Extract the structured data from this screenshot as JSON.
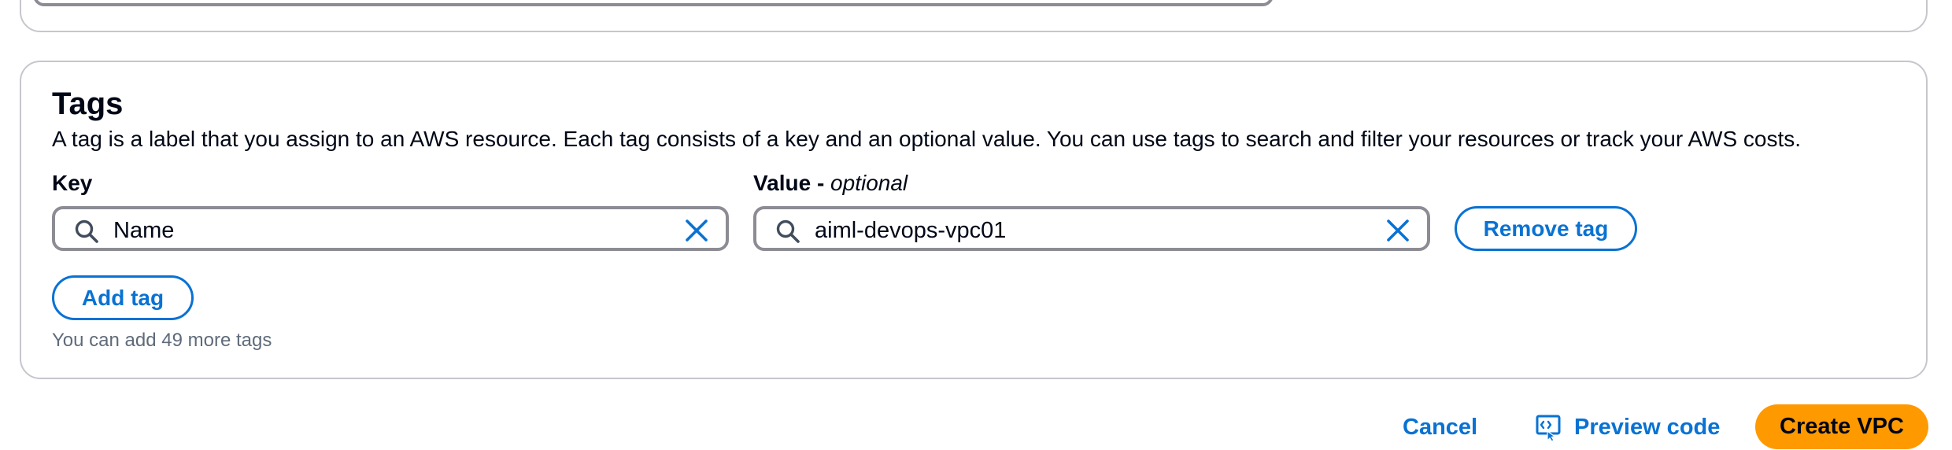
{
  "tags_section": {
    "title": "Tags",
    "description": "A tag is a label that you assign to an AWS resource. Each tag consists of a key and an optional value. You can use tags to search and filter your resources or track your AWS costs.",
    "key_label": "Key",
    "value_label": "Value - ",
    "value_label_optional": "optional",
    "tags": [
      {
        "key": "Name",
        "value": "aiml-devops-vpc01",
        "remove_label": "Remove tag"
      }
    ],
    "add_tag_label": "Add tag",
    "hint": "You can add 49 more tags"
  },
  "footer": {
    "cancel_label": "Cancel",
    "preview_code_label": "Preview code",
    "create_label": "Create VPC"
  },
  "colors": {
    "link_blue": "#0972d3",
    "primary_orange": "#ff9900",
    "border_gray": "#8c8c94",
    "card_border": "#c6c6cd",
    "hint_gray": "#5f6b7a"
  },
  "icons": {
    "search": "search-icon",
    "clear": "close-icon",
    "preview": "preview-code-icon"
  }
}
